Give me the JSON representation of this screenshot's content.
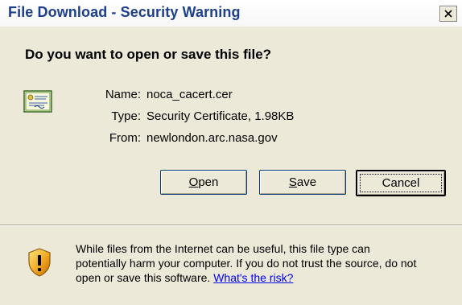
{
  "window": {
    "title": "File Download - Security Warning",
    "title_color": "#1d3f8c",
    "background": "#ece9d8"
  },
  "dialog": {
    "question": "Do you want to open or save this file?",
    "file_icon": "certificate-icon",
    "fields": {
      "name_label": "Name:",
      "name_value": "noca_cacert.cer",
      "type_label": "Type:",
      "type_value": "Security Certificate, 1.98KB",
      "from_label": "From:",
      "from_value": "newlondon.arc.nasa.gov"
    },
    "buttons": {
      "open_mnemonic": "O",
      "open_rest": "pen",
      "save_mnemonic": "S",
      "save_rest": "ave",
      "cancel_label": "Cancel"
    }
  },
  "warning": {
    "icon": "shield-icon",
    "line1": "While files from the Internet can be useful, this file type can",
    "line2": "potentially harm your computer. If you do not trust the source, do not",
    "line3_prefix": "open or save this software.",
    "link_text": "What's the risk?"
  }
}
